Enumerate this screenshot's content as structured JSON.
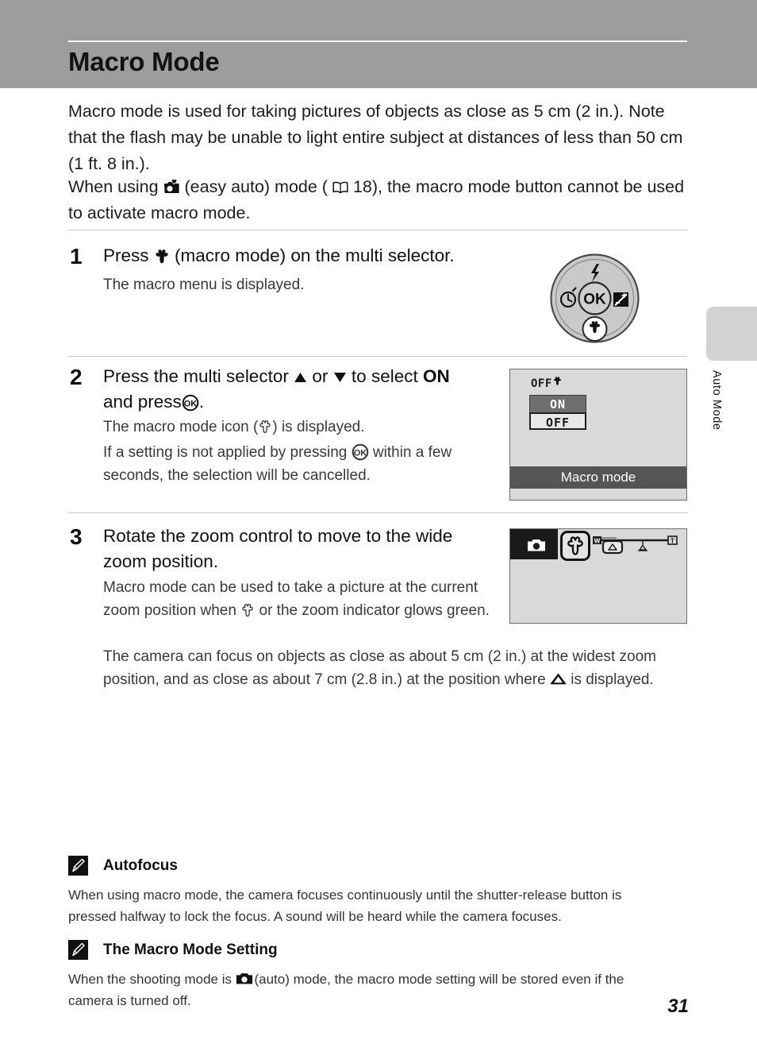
{
  "page": {
    "title": "Macro Mode",
    "number": "31",
    "side_tab_label": "Auto Mode",
    "header_bg": "#9d9d9d",
    "tab_bg": "#d2d2d2"
  },
  "intro": {
    "paragraph_1": "Macro mode is used for taking pictures of objects as close as 5 cm (2 in.). Note that the flash may be unable to light entire subject at distances of less than 50 cm (1 ft. 8 in.).",
    "paragraph_2_a": "When using",
    "paragraph_2_b": "(easy auto) mode (",
    "paragraph_2_page": "18",
    "paragraph_2_c": "), the macro mode button cannot be used to activate macro mode."
  },
  "steps": [
    {
      "number": "1",
      "title_a": "Press",
      "title_b": "(macro mode) on the multi selector.",
      "body": "The macro menu is displayed."
    },
    {
      "number": "2",
      "title_a": "Press the multi selector",
      "title_or": "or",
      "title_b": "to select",
      "title_on": "ON",
      "title_c": "and press",
      "title_d": ".",
      "body_a_1": "The macro mode icon (",
      "body_a_2": ") is displayed.",
      "body_b_1": "If a setting is not applied by pressing",
      "body_b_2": "within a few seconds, the selection will be cancelled."
    },
    {
      "number": "3",
      "title": "Rotate the zoom control to move to the wide zoom position.",
      "body_a_1": "Macro mode can be used to take a picture at the current zoom position when",
      "body_a_2": "or the zoom indicator glows green.",
      "body_b_1": "The camera can focus on objects as close as about 5 cm (2 in.) at the widest zoom position, and as close as about 7 cm (2.8 in.) at the position where",
      "body_b_2": "is displayed."
    }
  ],
  "dial": {
    "center_label": "OK",
    "buttons": [
      "flash-icon",
      "self-timer-icon",
      "exposure-compensation-icon",
      "macro-icon"
    ]
  },
  "lcd_step2": {
    "top_indicator": "OFF",
    "menu_options": [
      "ON",
      "OFF"
    ],
    "selected_option": "OFF",
    "caption": "Macro mode",
    "caption_bg": "#555555",
    "screen_bg": "#d9d9d9"
  },
  "lcd_step3": {
    "mode_icon": "auto-camera-icon",
    "macro_icon": "macro-tulip-icon",
    "zoom_wide_label": "W",
    "zoom_tele_label": "T",
    "screen_bg": "#d9d9d9"
  },
  "notes": [
    {
      "title": "Autofocus",
      "body": "When using macro mode, the camera focuses continuously until the shutter-release button is pressed halfway to lock the focus. A sound will be heard while the camera focuses."
    },
    {
      "title": "The Macro Mode Setting",
      "body_a": "When the shooting mode is",
      "body_b": "(auto) mode, the macro mode setting will be stored even if the camera is turned off."
    }
  ]
}
